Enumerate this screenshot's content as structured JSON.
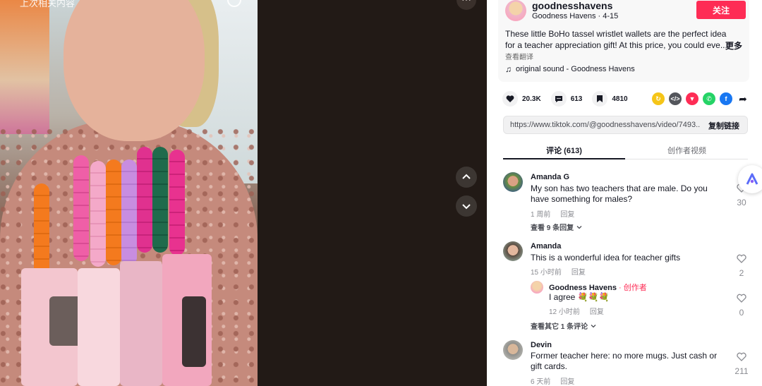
{
  "video": {
    "overlay_text": "上次相关内容",
    "more_label": "···"
  },
  "author": {
    "username": "goodnesshavens",
    "nickname_date": "Goodness Havens · 4-15",
    "follow_label": "关注"
  },
  "description": {
    "text": "These little BoHo tassel wristlet wallets are the perfect idea for a teacher appreciation gift! At this price, you could eve...",
    "more_label": "更多",
    "translate_label": "查看翻译",
    "sound": "original sound - Goodness Havens"
  },
  "stats": {
    "likes": "20.3K",
    "comments": "613",
    "saves": "4810"
  },
  "share": {
    "icons": [
      "repost-icon",
      "embed-icon",
      "send-icon",
      "whatsapp-icon",
      "facebook-icon",
      "share-arrow-icon"
    ],
    "colors": [
      "#f5c518",
      "#54565c",
      "#fe2c55",
      "#25d366",
      "#1877f2",
      "#161823"
    ]
  },
  "link": {
    "url": "https://www.tiktok.com/@goodnesshavens/video/7493...",
    "copy_label": "复制链接"
  },
  "tabs": {
    "comments": "评论 (613)",
    "creator_videos": "创作者视频"
  },
  "comments": [
    {
      "name": "Amanda G",
      "text": "My son has two teachers that are male. Do you have something for males?",
      "time": "1 周前",
      "reply_label": "回复",
      "likes": "30",
      "view_replies": "查看 9 条回复"
    },
    {
      "name": "Amanda",
      "text": "This is a wonderful idea for teacher gifts",
      "time": "15 小时前",
      "reply_label": "回复",
      "likes": "2",
      "reply": {
        "name": "Goodness Havens",
        "creator_tag": "· 创作者",
        "text": "I agree 💐💐💐",
        "time": "12 小时前",
        "reply_label": "回复",
        "likes": "0"
      },
      "view_replies": "查看其它 1 条评论"
    },
    {
      "name": "Devin",
      "text": "Former teacher here: no more mugs. Just cash or gift cards.",
      "time": "6 天前",
      "reply_label": "回复",
      "likes": "211"
    }
  ],
  "colors": {
    "accent": "#fe2c55",
    "video_bg": "#221a16"
  }
}
